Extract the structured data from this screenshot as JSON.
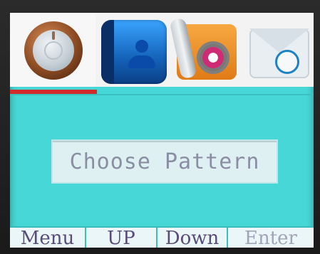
{
  "icons": [
    {
      "name": "power-icon"
    },
    {
      "name": "contacts-icon"
    },
    {
      "name": "settings-icon"
    },
    {
      "name": "mail-icon"
    }
  ],
  "main": {
    "button_label": "Choose Pattern"
  },
  "softkeys": {
    "menu": "Menu",
    "up": "UP",
    "down": "Down",
    "enter": "Enter"
  },
  "colors": {
    "screen_bg": "#46d7d6",
    "selection": "#d12b2b",
    "button_bg": "#dff0f2"
  }
}
